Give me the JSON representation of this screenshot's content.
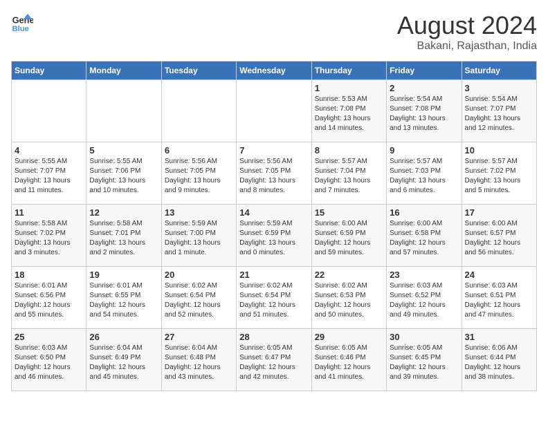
{
  "header": {
    "logo_line1": "General",
    "logo_line2": "Blue",
    "month": "August 2024",
    "location": "Bakani, Rajasthan, India"
  },
  "days_of_week": [
    "Sunday",
    "Monday",
    "Tuesday",
    "Wednesday",
    "Thursday",
    "Friday",
    "Saturday"
  ],
  "weeks": [
    [
      {
        "day": "",
        "info": ""
      },
      {
        "day": "",
        "info": ""
      },
      {
        "day": "",
        "info": ""
      },
      {
        "day": "",
        "info": ""
      },
      {
        "day": "1",
        "info": "Sunrise: 5:53 AM\nSunset: 7:08 PM\nDaylight: 13 hours\nand 14 minutes."
      },
      {
        "day": "2",
        "info": "Sunrise: 5:54 AM\nSunset: 7:08 PM\nDaylight: 13 hours\nand 13 minutes."
      },
      {
        "day": "3",
        "info": "Sunrise: 5:54 AM\nSunset: 7:07 PM\nDaylight: 13 hours\nand 12 minutes."
      }
    ],
    [
      {
        "day": "4",
        "info": "Sunrise: 5:55 AM\nSunset: 7:07 PM\nDaylight: 13 hours\nand 11 minutes."
      },
      {
        "day": "5",
        "info": "Sunrise: 5:55 AM\nSunset: 7:06 PM\nDaylight: 13 hours\nand 10 minutes."
      },
      {
        "day": "6",
        "info": "Sunrise: 5:56 AM\nSunset: 7:05 PM\nDaylight: 13 hours\nand 9 minutes."
      },
      {
        "day": "7",
        "info": "Sunrise: 5:56 AM\nSunset: 7:05 PM\nDaylight: 13 hours\nand 8 minutes."
      },
      {
        "day": "8",
        "info": "Sunrise: 5:57 AM\nSunset: 7:04 PM\nDaylight: 13 hours\nand 7 minutes."
      },
      {
        "day": "9",
        "info": "Sunrise: 5:57 AM\nSunset: 7:03 PM\nDaylight: 13 hours\nand 6 minutes."
      },
      {
        "day": "10",
        "info": "Sunrise: 5:57 AM\nSunset: 7:02 PM\nDaylight: 13 hours\nand 5 minutes."
      }
    ],
    [
      {
        "day": "11",
        "info": "Sunrise: 5:58 AM\nSunset: 7:02 PM\nDaylight: 13 hours\nand 3 minutes."
      },
      {
        "day": "12",
        "info": "Sunrise: 5:58 AM\nSunset: 7:01 PM\nDaylight: 13 hours\nand 2 minutes."
      },
      {
        "day": "13",
        "info": "Sunrise: 5:59 AM\nSunset: 7:00 PM\nDaylight: 13 hours\nand 1 minute."
      },
      {
        "day": "14",
        "info": "Sunrise: 5:59 AM\nSunset: 6:59 PM\nDaylight: 13 hours\nand 0 minutes."
      },
      {
        "day": "15",
        "info": "Sunrise: 6:00 AM\nSunset: 6:59 PM\nDaylight: 12 hours\nand 59 minutes."
      },
      {
        "day": "16",
        "info": "Sunrise: 6:00 AM\nSunset: 6:58 PM\nDaylight: 12 hours\nand 57 minutes."
      },
      {
        "day": "17",
        "info": "Sunrise: 6:00 AM\nSunset: 6:57 PM\nDaylight: 12 hours\nand 56 minutes."
      }
    ],
    [
      {
        "day": "18",
        "info": "Sunrise: 6:01 AM\nSunset: 6:56 PM\nDaylight: 12 hours\nand 55 minutes."
      },
      {
        "day": "19",
        "info": "Sunrise: 6:01 AM\nSunset: 6:55 PM\nDaylight: 12 hours\nand 54 minutes."
      },
      {
        "day": "20",
        "info": "Sunrise: 6:02 AM\nSunset: 6:54 PM\nDaylight: 12 hours\nand 52 minutes."
      },
      {
        "day": "21",
        "info": "Sunrise: 6:02 AM\nSunset: 6:54 PM\nDaylight: 12 hours\nand 51 minutes."
      },
      {
        "day": "22",
        "info": "Sunrise: 6:02 AM\nSunset: 6:53 PM\nDaylight: 12 hours\nand 50 minutes."
      },
      {
        "day": "23",
        "info": "Sunrise: 6:03 AM\nSunset: 6:52 PM\nDaylight: 12 hours\nand 49 minutes."
      },
      {
        "day": "24",
        "info": "Sunrise: 6:03 AM\nSunset: 6:51 PM\nDaylight: 12 hours\nand 47 minutes."
      }
    ],
    [
      {
        "day": "25",
        "info": "Sunrise: 6:03 AM\nSunset: 6:50 PM\nDaylight: 12 hours\nand 46 minutes."
      },
      {
        "day": "26",
        "info": "Sunrise: 6:04 AM\nSunset: 6:49 PM\nDaylight: 12 hours\nand 45 minutes."
      },
      {
        "day": "27",
        "info": "Sunrise: 6:04 AM\nSunset: 6:48 PM\nDaylight: 12 hours\nand 43 minutes."
      },
      {
        "day": "28",
        "info": "Sunrise: 6:05 AM\nSunset: 6:47 PM\nDaylight: 12 hours\nand 42 minutes."
      },
      {
        "day": "29",
        "info": "Sunrise: 6:05 AM\nSunset: 6:46 PM\nDaylight: 12 hours\nand 41 minutes."
      },
      {
        "day": "30",
        "info": "Sunrise: 6:05 AM\nSunset: 6:45 PM\nDaylight: 12 hours\nand 39 minutes."
      },
      {
        "day": "31",
        "info": "Sunrise: 6:06 AM\nSunset: 6:44 PM\nDaylight: 12 hours\nand 38 minutes."
      }
    ]
  ]
}
